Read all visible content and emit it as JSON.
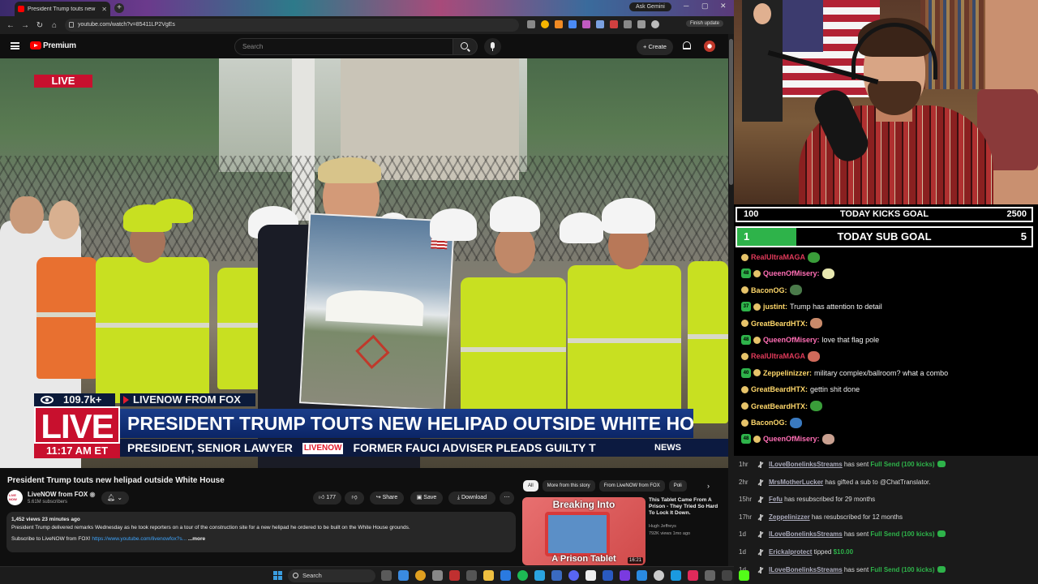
{
  "browser": {
    "tab_title": "President Trump touts new",
    "url": "youtube.com/watch?v=85411LP2VgEs",
    "ask_gemini": "Ask Gemini",
    "finish_update": "Finish update"
  },
  "youtube": {
    "brand": "Premium",
    "search_placeholder": "Search",
    "create_label": "+ Create",
    "video": {
      "live_badge": "LIVE",
      "chyron": {
        "views": "109.7k+",
        "source": "LIVENOW FROM FOX",
        "live": "LIVE",
        "time": "11:17 AM ET",
        "headline": "PRESIDENT TRUMP TOUTS NEW HELIPAD OUTSIDE WHITE HOUSE",
        "ticker_left": "PRESIDENT,  SENIOR LAWYER",
        "ticker_logo": "LIVENOW",
        "ticker_right": "FORMER FAUCI ADVISER PLEADS GUILTY T",
        "news": "NEWS"
      }
    },
    "title": "President Trump touts new helipad outside White House",
    "channel": {
      "name": "LiveNOW from FOX",
      "subs": "5.61M subscribers"
    },
    "actions": {
      "likes": "177",
      "share": "Share",
      "save": "Save",
      "download": "Download"
    },
    "description": {
      "meta": "1,452 views  23 minutes ago",
      "text": "President Trump delivered remarks Wednesday as he took reporters on a tour of the construction site for a new helipad he ordered to be built on the White House grounds.",
      "subscribe_line": "Subscribe to LiveNOW from FOX!",
      "link": "https://www.youtube.com/livenowfox?s...",
      "more": "...more"
    },
    "chips": [
      "All",
      "More from this story",
      "From LiveNOW from FOX",
      "Poli"
    ],
    "recommendation": {
      "thumb_top": "Breaking Into",
      "thumb_bottom": "A Prison Tablet",
      "duration": "16:21",
      "title": "This Tablet Came From A Prison - They Tried So Hard To Lock It Down.",
      "channel": "Hugh Jeffreys",
      "meta": "792K views  1mo ago"
    }
  },
  "goals": {
    "kicks": {
      "label": "TODAY KICKS GOAL",
      "start": "100",
      "target": "2500",
      "progress": 0
    },
    "subs": {
      "label": "TODAY SUB GOAL",
      "start": "1",
      "target": "5",
      "progress": 0.2
    }
  },
  "chat": [
    {
      "user": "RealUltraMAGA",
      "color": "#e03a5a",
      "badge": "",
      "text": "",
      "emote": "#3a9d3a"
    },
    {
      "user": "QueenOfMisery:",
      "color": "#ff6eb4",
      "badge": "48",
      "text": "",
      "emote": "#e8e8b0"
    },
    {
      "user": "BaconOG:",
      "color": "#ffd86b",
      "badge": "",
      "text": "",
      "emote": "#4a7a4a"
    },
    {
      "user": "justint:",
      "color": "#ffd86b",
      "badge": "37",
      "text": "Trump has attention to detail",
      "emote": ""
    },
    {
      "user": "GreatBeardHTX:",
      "color": "#ffd86b",
      "badge": "",
      "text": "",
      "emote": "#c98a6a"
    },
    {
      "user": "QueenOfMisery:",
      "color": "#ff6eb4",
      "badge": "48",
      "text": "love that flag pole",
      "emote": ""
    },
    {
      "user": "RealUltraMAGA",
      "color": "#e03a5a",
      "badge": "",
      "text": "",
      "emote": "#d06a5a"
    },
    {
      "user": "Zeppelinizzer:",
      "color": "#ffd86b",
      "badge": "40",
      "text": "military complex/ballroom? what a combo",
      "emote": ""
    },
    {
      "user": "GreatBeardHTX:",
      "color": "#ffd86b",
      "badge": "",
      "text": "gettin shit done",
      "emote": ""
    },
    {
      "user": "GreatBeardHTX:",
      "color": "#ffd86b",
      "badge": "",
      "text": "",
      "emote": "#3a9d3a"
    },
    {
      "user": "BaconOG:",
      "color": "#ffd86b",
      "badge": "",
      "text": "",
      "emote": "#3a7ac0"
    },
    {
      "user": "QueenOfMisery:",
      "color": "#ff6eb4",
      "badge": "48",
      "text": "",
      "emote": "#c9a090"
    }
  ],
  "events": [
    {
      "age": "1hr",
      "user": "ILoveBonelinksStreams",
      "text": " has sent ",
      "hl": "Full Send (100 kicks)",
      "gem": true
    },
    {
      "age": "2hr",
      "user": "MrsMotherLucker",
      "text": " has gifted a sub to @ChatTranslator.",
      "hl": "",
      "gem": false
    },
    {
      "age": "15hr",
      "user": "Fefu",
      "text": " has resubscribed for 29 months",
      "hl": "",
      "gem": false
    },
    {
      "age": "17hr",
      "user": "Zeppelinizzer",
      "text": " has resubscribed for 12 months",
      "hl": "",
      "gem": false
    },
    {
      "age": "1d",
      "user": "ILoveBonelinksStreams",
      "text": " has sent ",
      "hl": "Full Send (100 kicks)",
      "gem": true
    },
    {
      "age": "1d",
      "user": "Erickalprotect",
      "text": " tipped ",
      "hl": "$10.00",
      "gem": false
    },
    {
      "age": "1d",
      "user": "ILoveBonelinksStreams",
      "text": " has sent ",
      "hl": "Full Send (100 kicks)",
      "gem": true
    }
  ],
  "taskbar": {
    "search": "Search"
  }
}
